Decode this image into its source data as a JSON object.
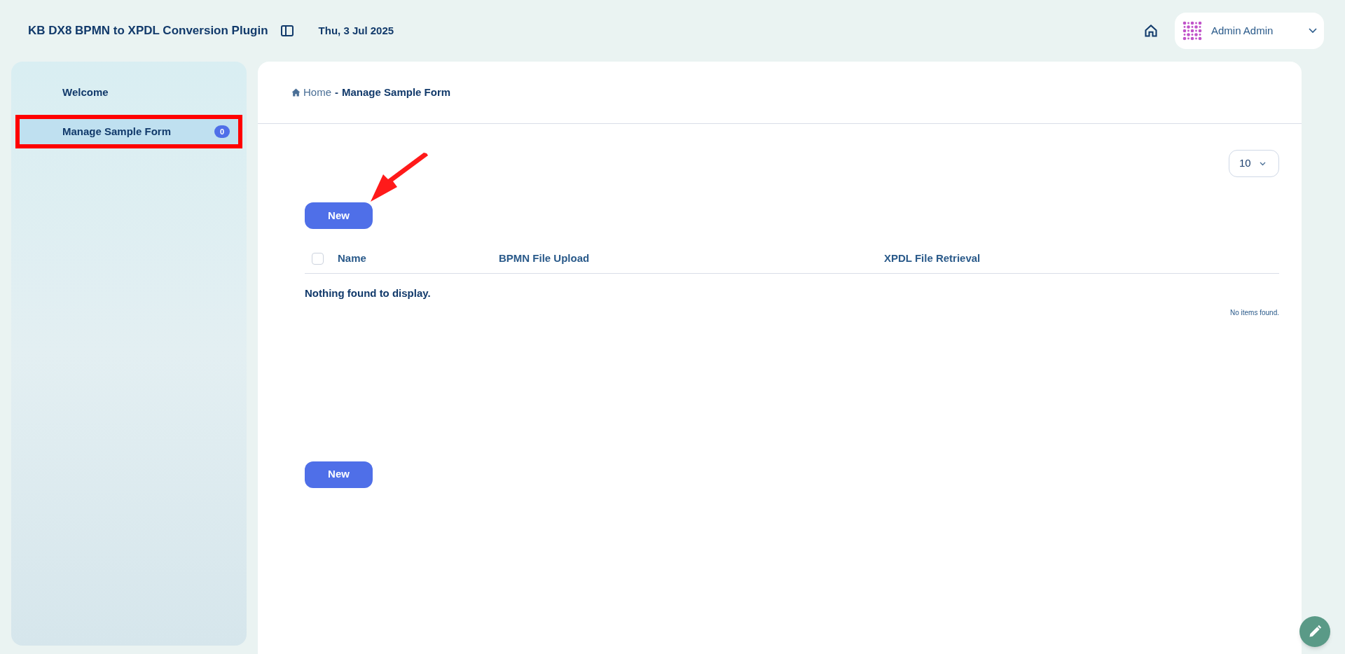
{
  "header": {
    "title": "KB DX8 BPMN to XPDL Conversion Plugin",
    "date": "Thu, 3 Jul 2025",
    "user": "Admin Admin"
  },
  "sidebar": {
    "items": [
      {
        "label": "Welcome",
        "selected": false,
        "highlighted": false
      },
      {
        "label": "Manage Sample Form",
        "badge": "0",
        "selected": true,
        "highlighted": true
      }
    ]
  },
  "breadcrumb": {
    "home": "Home",
    "separator": "-",
    "current": "Manage Sample Form"
  },
  "page_size": "10",
  "new_buttons": [
    "New",
    "New"
  ],
  "table": {
    "select_all_checked": false,
    "columns": [
      "Name",
      "BPMN File Upload",
      "XPDL File Retrieval"
    ],
    "empty_message": "Nothing found to display.",
    "footer": "No items found."
  }
}
